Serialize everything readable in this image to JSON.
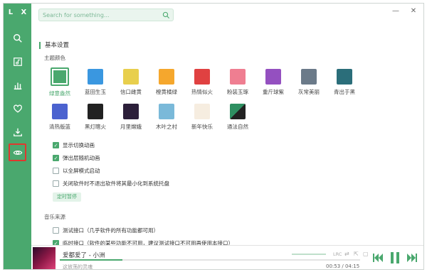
{
  "app": {
    "logo": "L X"
  },
  "search": {
    "placeholder": "Search for something..."
  },
  "settings": {
    "section_title": "基本设置",
    "theme_label": "主题颜色",
    "themes": [
      {
        "label": "绿意盎然",
        "color": "#4aa86e"
      },
      {
        "label": "蓝田生玉",
        "color": "#3a97e0"
      },
      {
        "label": "信口雌黄",
        "color": "#e8cf4d"
      },
      {
        "label": "橙黄橘绿",
        "color": "#f5a72d"
      },
      {
        "label": "热情似火",
        "color": "#e04141"
      },
      {
        "label": "粉装玉琢",
        "color": "#ef7e91"
      },
      {
        "label": "重斤球紫",
        "color": "#9450c0"
      },
      {
        "label": "灰常美丽",
        "color": "#6b7a89"
      },
      {
        "label": "青出于黑",
        "color": "#2b6e7a"
      },
      {
        "label": "清热版蓝",
        "color": "#4b62cf"
      },
      {
        "label": "黑灯瞎火",
        "color": "#222222"
      },
      {
        "label": "月里嫦娥",
        "color": "#2c1f3a"
      },
      {
        "label": "木叶之村",
        "color": "#7ab9d9"
      },
      {
        "label": "新年快乐",
        "color": "#f6ede0"
      },
      {
        "label": "通法自然",
        "color": "#2e8f61"
      }
    ],
    "options": [
      {
        "label": "显示切换动画",
        "checked": true
      },
      {
        "label": "弹出层随机动画",
        "checked": true
      },
      {
        "label": "以全屏模式启动",
        "checked": false
      },
      {
        "label": "关闭软件时不退出软件将其最小化到系统托盘",
        "checked": false
      }
    ],
    "timer_button": "定时暂停",
    "source_label": "音乐来源",
    "sources": [
      {
        "label": "测试接口（几乎软件的所有功能都可用）",
        "checked": false
      },
      {
        "label": "临时接口（软件的某些功能不可用，建议测试接口不可用再使用本接口）",
        "checked": true
      }
    ]
  },
  "player": {
    "title": "爱都爱了 - 小洲",
    "subtitle": "这放荡的灵魂",
    "time": "00:53 / 04:15",
    "progress": 0.208,
    "lrc": "LRC"
  },
  "colors": {
    "accent": "#4aa86e",
    "sidebar": "#4aa86e",
    "highlight_border": "#e0382e"
  }
}
